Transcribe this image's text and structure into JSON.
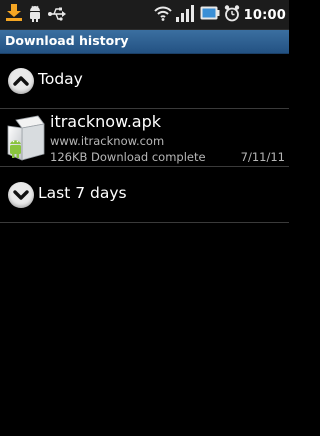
{
  "status_bar": {
    "time": "10:00",
    "left_icons": [
      "download-notification-icon",
      "android-notification-icon",
      "usb-icon"
    ],
    "right_icons": [
      "wifi-icon",
      "signal-icon",
      "battery-icon",
      "alarm-icon"
    ]
  },
  "title_bar": {
    "title": "Download history"
  },
  "groups": [
    {
      "label": "Today",
      "state": "expanded",
      "icon": "chevron-up-icon"
    },
    {
      "label": "Last 7 days",
      "state": "collapsed",
      "icon": "chevron-down-icon"
    }
  ],
  "downloads": [
    {
      "name": "itracknow.apk",
      "url": "www.itracknow.com",
      "status": "126KB Download complete",
      "date": "7/11/11",
      "icon": "apk-package-icon"
    }
  ],
  "colors": {
    "background": "#000000",
    "title_bar": "#2f5f91",
    "secondary_text": "#b7b7b7"
  }
}
